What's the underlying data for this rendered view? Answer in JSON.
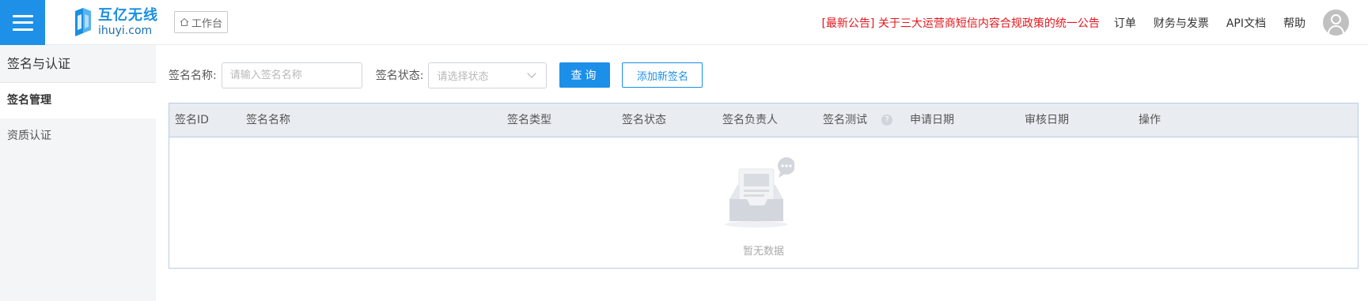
{
  "header": {
    "logo_cn": "互亿无线",
    "logo_en": "ihuyi.com",
    "workbench_label": "工作台",
    "notice": "[最新公告] 关于三大运营商短信内容合规政策的统一公告",
    "nav_links": [
      "订单",
      "财务与发票",
      "API文档",
      "帮助"
    ],
    "brand_color": "#1e90e8",
    "notice_color": "#e4161c"
  },
  "sidebar": {
    "title": "签名与认证",
    "items": [
      {
        "label": "签名管理",
        "active": true
      },
      {
        "label": "资质认证",
        "active": false
      }
    ]
  },
  "filter": {
    "name_label": "签名名称:",
    "name_placeholder": "请输入签名名称",
    "status_label": "签名状态:",
    "status_placeholder": "请选择状态",
    "query_button": "查询",
    "add_button": "添加新签名"
  },
  "table": {
    "columns": [
      "签名ID",
      "签名名称",
      "签名类型",
      "签名状态",
      "签名负责人",
      "签名测试",
      "申请日期",
      "审核日期",
      "操作"
    ],
    "rows": [],
    "help_icon": "?",
    "empty_text": "暂无数据"
  }
}
